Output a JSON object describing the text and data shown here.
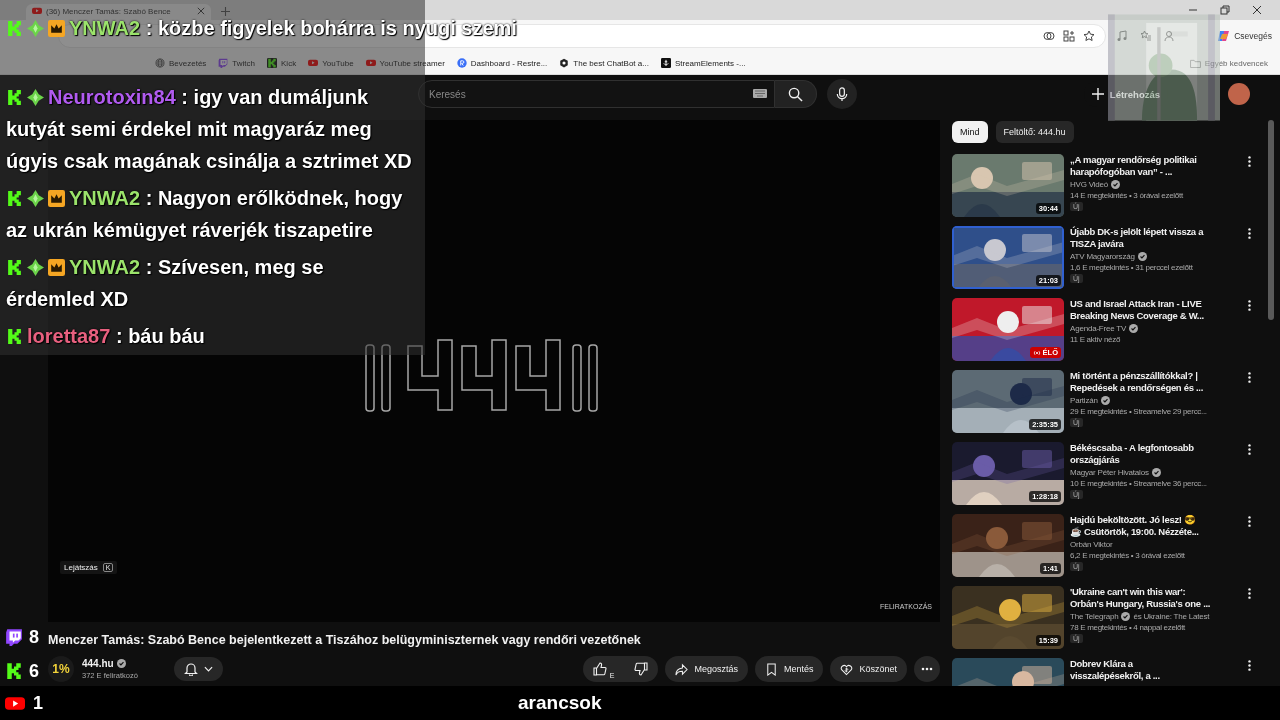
{
  "browser": {
    "tab_title": "(36) Menczer Tamás: Szabó Bence",
    "chat_button": "Csevegés",
    "bookmarks": [
      {
        "label": "Bevezetés",
        "kind": "globe"
      },
      {
        "label": "Twitch",
        "kind": "twitch"
      },
      {
        "label": "Kick",
        "kind": "kick"
      },
      {
        "label": "YouTube",
        "kind": "youtube"
      },
      {
        "label": "YouTube streamer",
        "kind": "youtube"
      },
      {
        "label": "Dashboard - Restre...",
        "kind": "restream"
      },
      {
        "label": "The best ChatBot a...",
        "kind": "chatbot"
      },
      {
        "label": "StreamElements -...",
        "kind": "streamelements"
      }
    ],
    "other_bookmarks": "Egyéb kedvencek"
  },
  "youtube": {
    "search": {
      "placeholder": "Keresés"
    },
    "create_button": "Létrehozás",
    "player": {
      "tooltip": "Lejátszás",
      "tooltip_key": "K",
      "watermark": "FELIRATKOZÁS"
    },
    "video": {
      "title": "Menczer Tamás: Szabó Bence bejelentkezett a Tiszához belügyminiszternek vagy rendőri vezetőnek",
      "channel_avatar": "1%",
      "channel": "444.hu",
      "verified": true,
      "subscribers": "372 E feliratkozó",
      "like_count": "E",
      "actions": [
        {
          "label": "Megosztás",
          "kind": "share"
        },
        {
          "label": "Mentés",
          "kind": "save"
        },
        {
          "label": "Köszönet",
          "kind": "thanks"
        }
      ]
    },
    "chips": [
      {
        "label": "Mind",
        "selected": true
      },
      {
        "label": "Feltöltő: 444.hu",
        "selected": false
      }
    ],
    "recommendations": [
      {
        "title_lines": [
          "„A magyar rendőrség politikai",
          "harapófogóban van” - ..."
        ],
        "channel": "HVG Videó",
        "verified": true,
        "stats": "14 E megtekintés • 3 órával ezelőtt",
        "duration": "30:44",
        "badge": "Új",
        "highlighted": false
      },
      {
        "title_lines": [
          "Újabb DK-s jelölt lépett vissza a",
          "TISZA javára"
        ],
        "channel": "ATV Magyarország",
        "verified": true,
        "stats": "1,6 E megtekintés • 31 perccel ezelőtt",
        "duration": "21:03",
        "badge": "Új",
        "highlighted": true
      },
      {
        "title_lines": [
          "US and Israel Attack Iran - LIVE",
          "Breaking News Coverage & W..."
        ],
        "channel": "Agenda-Free TV",
        "verified": true,
        "stats": "11 E aktív néző",
        "live_label": "ÉLŐ",
        "highlighted": false
      },
      {
        "title_lines": [
          "Mi történt a pénzszállítókkal? |",
          "Repedések a rendőrségen és ..."
        ],
        "channel": "Partizán",
        "verified": true,
        "stats": "29 E megtekintés • Streamelve 29 percc...",
        "duration": "2:35:35",
        "badge": "Új",
        "highlighted": false
      },
      {
        "title_lines": [
          "Békéscsaba - A legfontosabb",
          "országjárás"
        ],
        "channel": "Magyar Péter Hivatalos",
        "verified": true,
        "stats": "10 E megtekintés • Streamelve 36 percc...",
        "duration": "1:28:18",
        "badge": "Új",
        "highlighted": false
      },
      {
        "title_lines": [
          "Hajdú beköltözött. Jó lesz! 😎",
          "☕ Csütörtök, 19:00. Nézzéte..."
        ],
        "channel": "Orbán Viktor",
        "verified": false,
        "stats": "6,2 E megtekintés • 3 órával ezelőtt",
        "duration": "1:41",
        "badge": "Új",
        "highlighted": false
      },
      {
        "title_lines": [
          "'Ukraine can't win this war':",
          "Orbán's Hungary, Russia's one ..."
        ],
        "channel": "The Telegraph",
        "verified": true,
        "channel_suffix": "és Ukraine: The Latest",
        "stats": "78 E megtekintés • 4 nappal ezelőtt",
        "duration": "15:39",
        "badge": "Új",
        "highlighted": false
      },
      {
        "title_lines": [
          "Dobrev Klára a",
          "visszalépésekről, a ..."
        ],
        "highlighted": false
      }
    ]
  },
  "stream_overlay": {
    "chat": [
      {
        "badges": [
          {
            "kind": "kick"
          },
          {
            "kind": "gem"
          },
          {
            "kind": "crown"
          }
        ],
        "user": "YNWA2",
        "color": "#9be36b",
        "text": ": közbe figyelek bohárra is nyugi szemi"
      },
      {
        "badges": [
          {
            "kind": "kick"
          },
          {
            "kind": "gem"
          }
        ],
        "user": "Neurotoxin84",
        "color": "#b15bf0",
        "text": ": igy van dumáljunk kutyát semi érdekel mit magyaráz meg úgyis csak magának csinálja a sztrimet XD"
      },
      {
        "badges": [
          {
            "kind": "kick"
          },
          {
            "kind": "gem"
          },
          {
            "kind": "crown"
          }
        ],
        "user": "YNWA2",
        "color": "#9be36b",
        "text": ": Nagyon erőlködnek, hogy az ukrán kémügyet ráverjék tiszapetire"
      },
      {
        "badges": [
          {
            "kind": "kick"
          },
          {
            "kind": "gem"
          },
          {
            "kind": "crown"
          }
        ],
        "user": "YNWA2",
        "color": "#9be36b",
        "text": ": Szívesen, meg se érdemled XD"
      },
      {
        "badges": [
          {
            "kind": "kick"
          }
        ],
        "user": "loretta87",
        "color": "#e8607f",
        "text": ": báu báu"
      }
    ],
    "counters": [
      {
        "kind": "twitch",
        "count": "8"
      },
      {
        "kind": "kick",
        "count": "6"
      }
    ],
    "bottom_bar": {
      "youtube_count": "1",
      "ticker": "arancsok"
    }
  }
}
